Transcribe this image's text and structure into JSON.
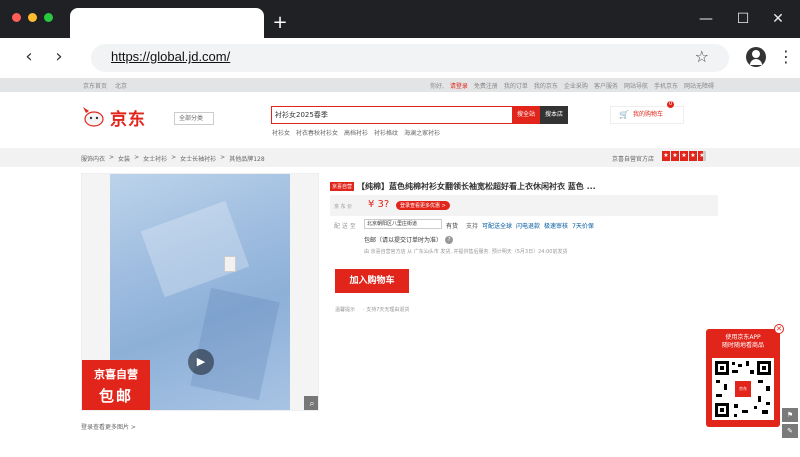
{
  "browser": {
    "url": "https://global.jd.com/",
    "new_tab": "+",
    "win_min": "—",
    "win_max": "☐",
    "win_close": "✕",
    "back": "‹",
    "forward": "›",
    "star": "☆",
    "menu": "⋮"
  },
  "shortcut": {
    "left": [
      "京东首页",
      "北京"
    ],
    "greeting": "你好,",
    "login": "请登录",
    "register": "免费注册",
    "right": [
      "我的订单",
      "我的京东",
      "企业采购",
      "客户服务",
      "网站导航",
      "手机京东",
      "网站无障碍"
    ]
  },
  "header": {
    "logo_text": "京东",
    "category_btn": "全部分类",
    "search_value": "衬衫女2025春季",
    "search_all": "搜全站",
    "search_store": "搜本店",
    "hotwords": [
      "衬衫女",
      "衬衣春秋衬衫女",
      "高档衬衫",
      "衬衫格纹",
      "海澜之家衬衫"
    ],
    "cart_label": "我的购物车",
    "cart_count": "0"
  },
  "breadcrumb": {
    "items": [
      "服饰内衣",
      ">",
      "女装",
      ">",
      "女士衬衫",
      ">",
      "女士长袖衬衫",
      ">",
      "其他品牌128"
    ],
    "shop_name": "京喜自营官方店",
    "rating_stars": [
      "★",
      "★",
      "★",
      "★",
      "★"
    ]
  },
  "gallery": {
    "promo_line1": "京喜自营",
    "promo_line2": "包邮",
    "play": "▶",
    "zoom": "⌕",
    "view_more": "登录查看更多图片 >"
  },
  "product": {
    "badge": "京喜自营",
    "title": "【纯棉】蓝色纯棉衬衫女翻领长袖宽松超好看上衣休闲衬衣 蓝色 ...",
    "price_label": "京 东 价",
    "price": "¥ 3?",
    "coupon": "登录查看更多优惠 >",
    "delivery_label": "配 送 至",
    "address": "北京朝阳区八里庄街道",
    "stock": "有货",
    "support_label": "支持",
    "support_links": [
      "可配送全球",
      "闪电退款",
      "极速审核",
      "7天价保"
    ],
    "ship_note": "包邮（请以提交订单时为准）",
    "help": "?",
    "from_line": "由 京喜自营官方店 从 广东汕头市 发货, 并提供售后服务. 预计明天（5月3日）24:00前发货",
    "add_to_cart": "加入购物车",
    "tips_label": "温馨提示",
    "tips_text": "· 支持7天无理由退货"
  },
  "qr_panel": {
    "close": "✕",
    "line1": "使用京东APP",
    "line2": "随时随地看商品",
    "logo": "京东"
  },
  "side_tools": [
    "⚑",
    "✎"
  ]
}
